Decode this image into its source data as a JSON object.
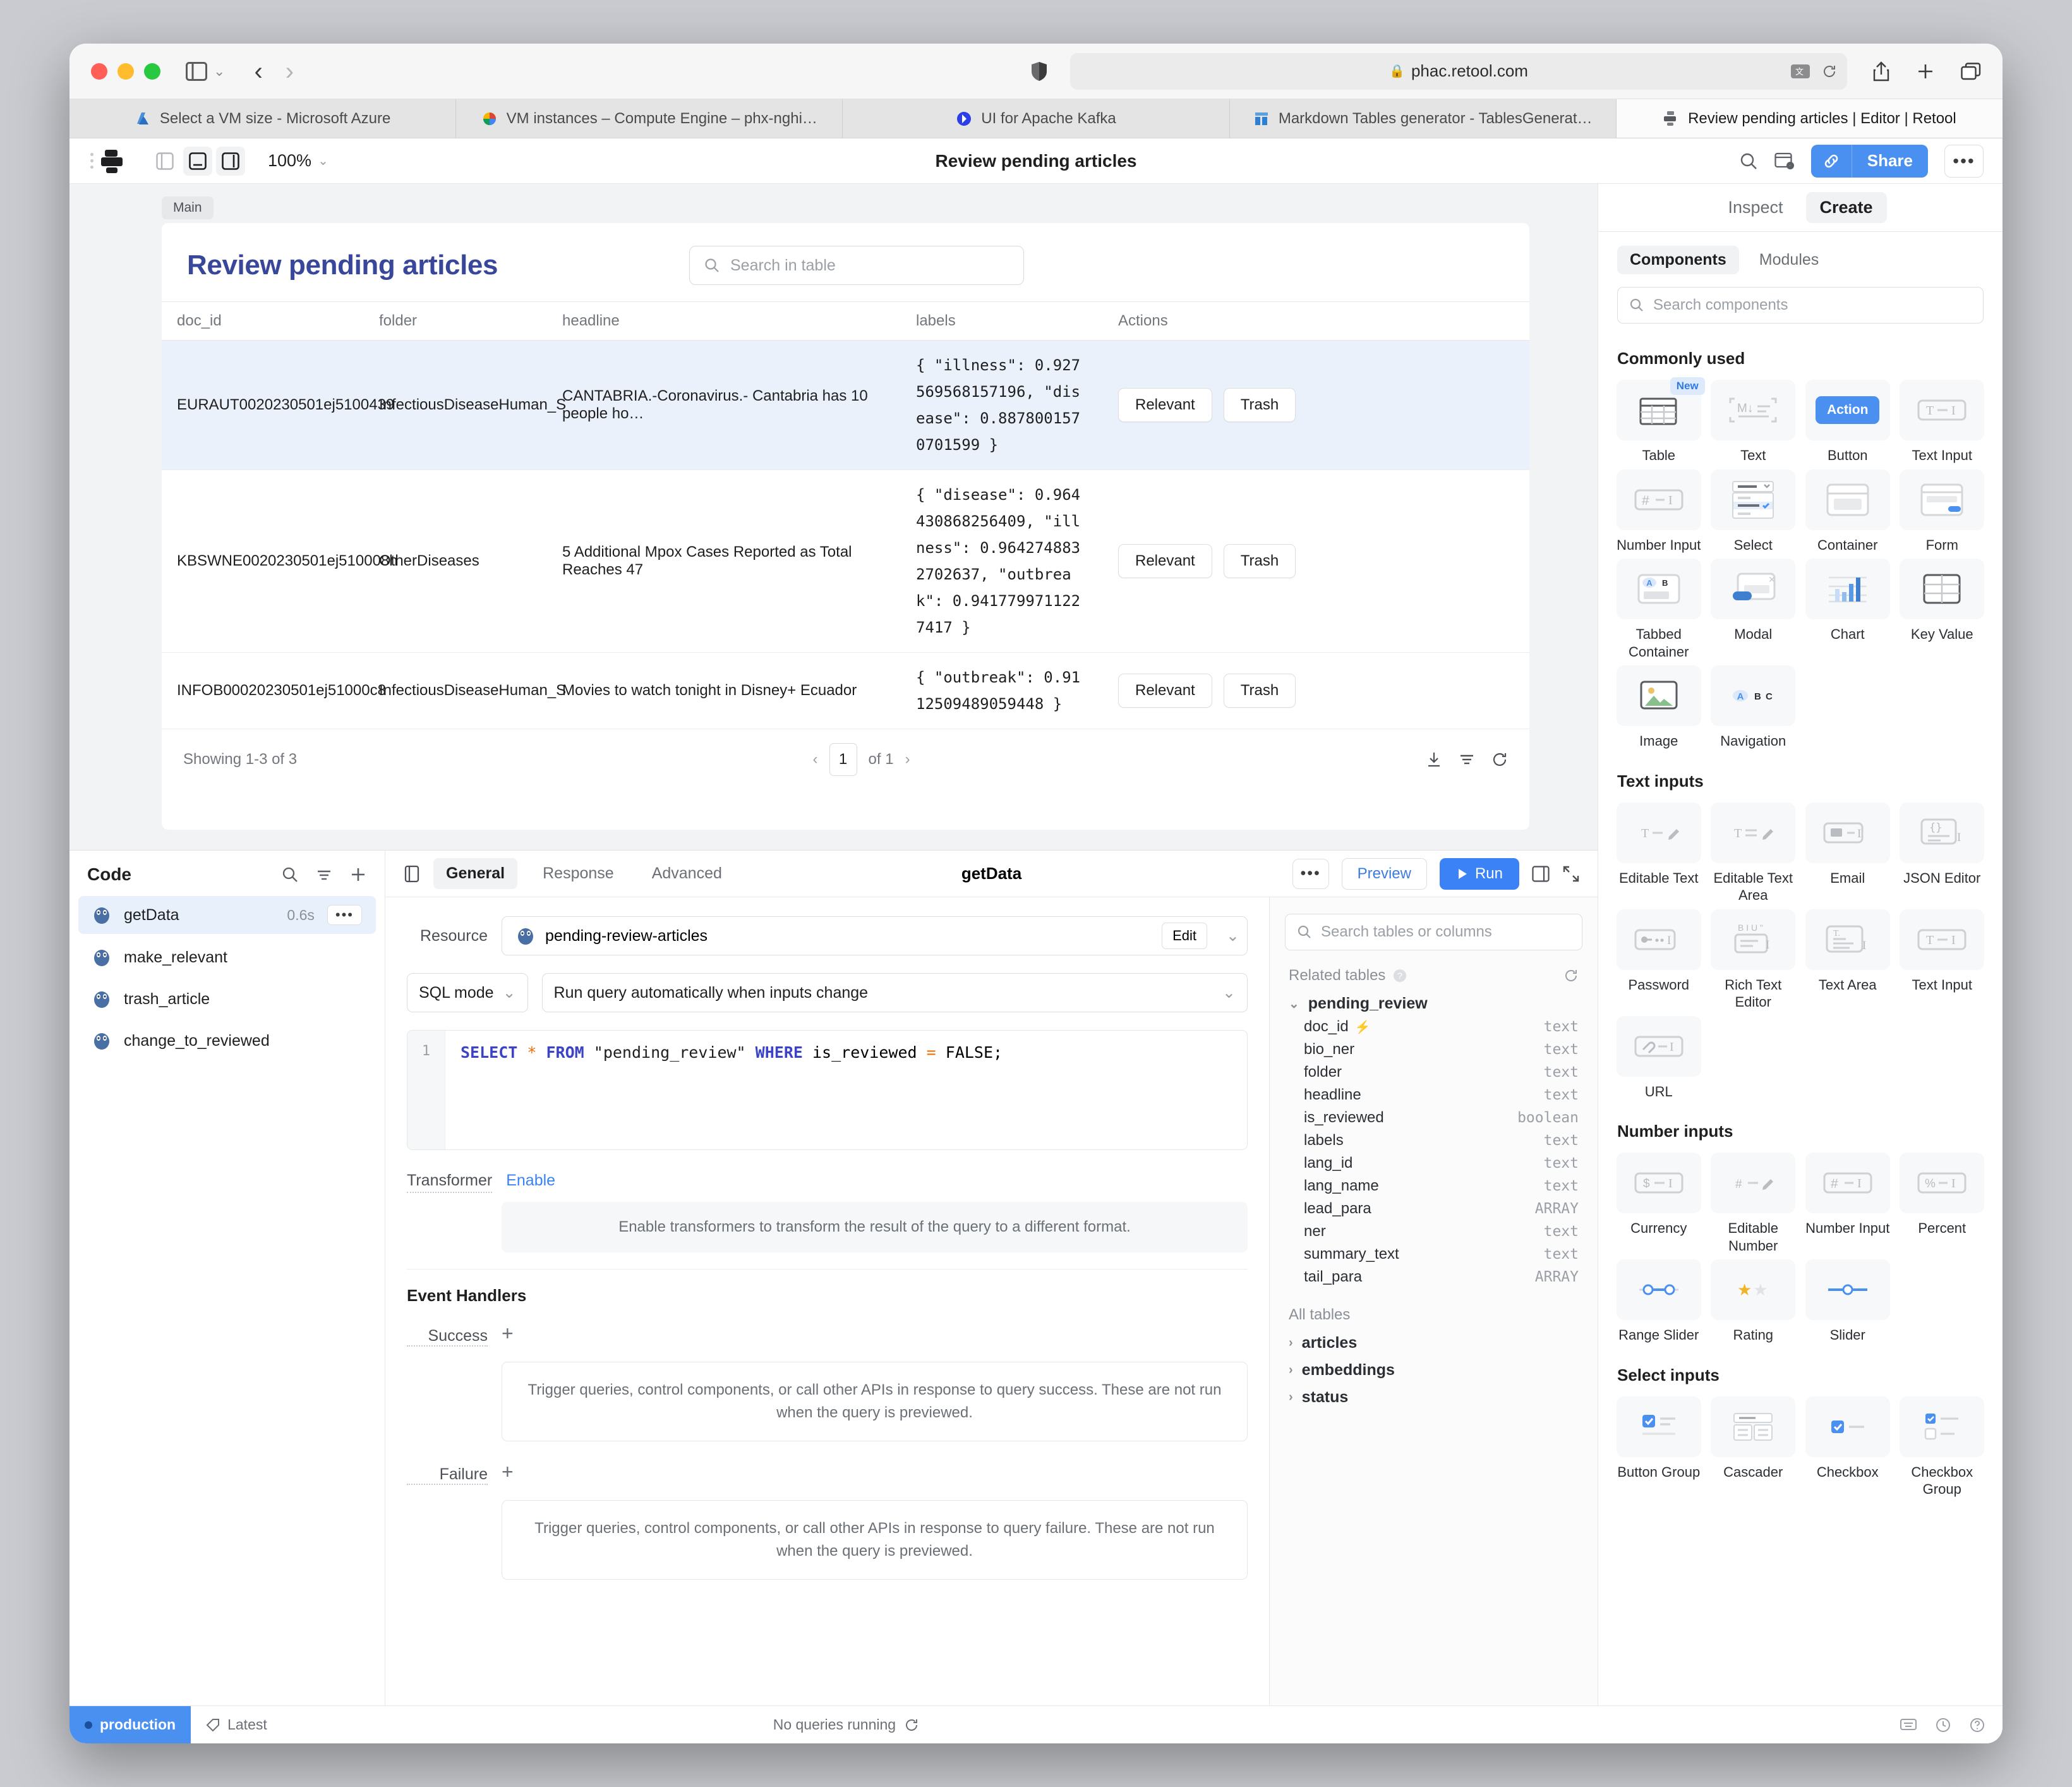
{
  "browser": {
    "url": "phac.retool.com",
    "tabs": [
      {
        "label": "Select a VM size - Microsoft Azure",
        "favicon": "azure-icon",
        "active": false
      },
      {
        "label": "VM instances – Compute Engine – phx-nghi…",
        "favicon": "google-cloud-icon",
        "active": false
      },
      {
        "label": "UI for Apache Kafka",
        "favicon": "kafka-icon",
        "active": false
      },
      {
        "label": "Markdown Tables generator - TablesGenerat…",
        "favicon": "tablesgenerator-icon",
        "active": false
      },
      {
        "label": "Review pending articles | Editor | Retool",
        "favicon": "retool-icon",
        "active": true
      }
    ]
  },
  "retool_header": {
    "zoom": "100%",
    "title": "Review pending articles",
    "share_label": "Share",
    "more_label": "•••"
  },
  "canvas": {
    "frame_chip": "Main",
    "app_title": "Review pending articles",
    "search_placeholder": "Search in table",
    "columns": [
      "doc_id",
      "folder",
      "headline",
      "labels",
      "Actions"
    ],
    "rows": [
      {
        "doc_id": "EURAUT0020230501ej5100439",
        "folder": "InfectiousDiseaseHuman_S",
        "headline": "CANTABRIA.-Coronavirus.- Cantabria has 10 people ho…",
        "labels": "{ \"illness\": 0.927569568157196, \"disease\": 0.8878001570701599 }",
        "selected": true,
        "actions": [
          "Relevant",
          "Trash"
        ]
      },
      {
        "doc_id": "KBSWNE0020230501ej510008h",
        "folder": "OtherDiseases",
        "headline": "5 Additional Mpox Cases Reported as Total Reaches 47",
        "labels": "{ \"disease\": 0.964430868256409, \"illness\": 0.9642748832702637, \"outbreak\": 0.9417799711227417 }",
        "selected": false,
        "actions": [
          "Relevant",
          "Trash"
        ]
      },
      {
        "doc_id": "INFOB00020230501ej51000c8",
        "folder": "InfectiousDiseaseHuman_S",
        "headline": "Movies to watch tonight in Disney+ Ecuador",
        "labels": "{ \"outbreak\": 0.9112509489059448 }",
        "selected": false,
        "actions": [
          "Relevant",
          "Trash"
        ]
      }
    ],
    "footer": {
      "showing": "Showing 1-3 of 3",
      "page": "1",
      "of": "of 1"
    }
  },
  "code_panel": {
    "title": "Code",
    "queries": [
      {
        "name": "getData",
        "duration": "0.6s",
        "selected": true
      },
      {
        "name": "make_relevant",
        "duration": "",
        "selected": false
      },
      {
        "name": "trash_article",
        "duration": "",
        "selected": false
      },
      {
        "name": "change_to_reviewed",
        "duration": "",
        "selected": false
      }
    ]
  },
  "editor": {
    "tabs": [
      "General",
      "Response",
      "Advanced"
    ],
    "active_tab": "General",
    "query_name": "getData",
    "preview_label": "Preview",
    "run_label": "Run",
    "resource_label": "Resource",
    "resource_value": "pending-review-articles",
    "resource_edit_label": "Edit",
    "sql_mode_label": "SQL mode",
    "run_behaviour": "Run query automatically when inputs change",
    "sql_line_number": "1",
    "sql": {
      "kw1": "SELECT",
      "star": "*",
      "kw2": "FROM",
      "table": "\"pending_review\"",
      "kw3": "WHERE",
      "col": "is_reviewed",
      "eq": "=",
      "val": "FALSE;"
    },
    "transformer_label": "Transformer",
    "transformer_enable": "Enable",
    "transformer_hint": "Enable transformers to transform the result of the query to a different format.",
    "event_handlers_title": "Event Handlers",
    "success_label": "Success",
    "success_hint": "Trigger queries, control components, or call other APIs in response to query success. These are not run when the query is previewed.",
    "failure_label": "Failure",
    "failure_hint": "Trigger queries, control components, or call other APIs in response to query failure. These are not run when the query is previewed."
  },
  "schema": {
    "search_placeholder": "Search tables or columns",
    "related_tables_label": "Related tables",
    "table_name": "pending_review",
    "columns": [
      {
        "name": "doc_id",
        "type": "text",
        "key": true
      },
      {
        "name": "bio_ner",
        "type": "text",
        "key": false
      },
      {
        "name": "folder",
        "type": "text",
        "key": false
      },
      {
        "name": "headline",
        "type": "text",
        "key": false
      },
      {
        "name": "is_reviewed",
        "type": "boolean",
        "key": false
      },
      {
        "name": "labels",
        "type": "text",
        "key": false
      },
      {
        "name": "lang_id",
        "type": "text",
        "key": false
      },
      {
        "name": "lang_name",
        "type": "text",
        "key": false
      },
      {
        "name": "lead_para",
        "type": "ARRAY",
        "key": false
      },
      {
        "name": "ner",
        "type": "text",
        "key": false
      },
      {
        "name": "summary_text",
        "type": "text",
        "key": false
      },
      {
        "name": "tail_para",
        "type": "ARRAY",
        "key": false
      }
    ],
    "all_tables_label": "All tables",
    "all_tables": [
      "articles",
      "embeddings",
      "status"
    ]
  },
  "right_panel": {
    "tabs": [
      "Inspect",
      "Create"
    ],
    "active_tab": "Create",
    "subtabs": [
      "Components",
      "Modules"
    ],
    "active_subtab": "Components",
    "search_placeholder": "Search components",
    "sections": [
      {
        "title": "Commonly used",
        "items": [
          {
            "label": "Table",
            "icon": "table-icon",
            "badge": "New"
          },
          {
            "label": "Text",
            "icon": "markdown-text-icon",
            "badge": ""
          },
          {
            "label": "Button",
            "icon": "button-action-icon",
            "badge": "",
            "inner": "Action"
          },
          {
            "label": "Text Input",
            "icon": "text-input-icon",
            "badge": ""
          },
          {
            "label": "Number Input",
            "icon": "number-input-icon",
            "badge": ""
          },
          {
            "label": "Select",
            "icon": "select-icon",
            "badge": ""
          },
          {
            "label": "Container",
            "icon": "container-icon",
            "badge": ""
          },
          {
            "label": "Form",
            "icon": "form-icon",
            "badge": ""
          },
          {
            "label": "Tabbed Container",
            "icon": "tabbed-container-icon",
            "badge": ""
          },
          {
            "label": "Modal",
            "icon": "modal-icon",
            "badge": ""
          },
          {
            "label": "Chart",
            "icon": "chart-icon",
            "badge": ""
          },
          {
            "label": "Key Value",
            "icon": "key-value-icon",
            "badge": ""
          },
          {
            "label": "Image",
            "icon": "image-icon",
            "badge": ""
          },
          {
            "label": "Navigation",
            "icon": "navigation-icon",
            "badge": ""
          }
        ]
      },
      {
        "title": "Text inputs",
        "items": [
          {
            "label": "Editable Text",
            "icon": "editable-text-icon",
            "badge": ""
          },
          {
            "label": "Editable Text Area",
            "icon": "editable-text-area-icon",
            "badge": ""
          },
          {
            "label": "Email",
            "icon": "email-icon",
            "badge": ""
          },
          {
            "label": "JSON Editor",
            "icon": "json-editor-icon",
            "badge": ""
          },
          {
            "label": "Password",
            "icon": "password-icon",
            "badge": ""
          },
          {
            "label": "Rich Text Editor",
            "icon": "rich-text-editor-icon",
            "badge": ""
          },
          {
            "label": "Text Area",
            "icon": "text-area-icon",
            "badge": ""
          },
          {
            "label": "Text Input",
            "icon": "text-input-icon",
            "badge": ""
          },
          {
            "label": "URL",
            "icon": "url-icon",
            "badge": ""
          }
        ]
      },
      {
        "title": "Number inputs",
        "items": [
          {
            "label": "Currency",
            "icon": "currency-icon",
            "badge": ""
          },
          {
            "label": "Editable Number",
            "icon": "editable-number-icon",
            "badge": ""
          },
          {
            "label": "Number Input",
            "icon": "number-input-icon",
            "badge": ""
          },
          {
            "label": "Percent",
            "icon": "percent-icon",
            "badge": ""
          },
          {
            "label": "Range Slider",
            "icon": "range-slider-icon",
            "badge": ""
          },
          {
            "label": "Rating",
            "icon": "rating-icon",
            "badge": ""
          },
          {
            "label": "Slider",
            "icon": "slider-icon",
            "badge": ""
          }
        ]
      },
      {
        "title": "Select inputs",
        "items": [
          {
            "label": "Button Group",
            "icon": "button-group-icon",
            "badge": ""
          },
          {
            "label": "Cascader",
            "icon": "cascader-icon",
            "badge": ""
          },
          {
            "label": "Checkbox",
            "icon": "checkbox-icon",
            "badge": ""
          },
          {
            "label": "Checkbox Group",
            "icon": "checkbox-group-icon",
            "badge": ""
          }
        ]
      }
    ]
  },
  "statusbar": {
    "env": "production",
    "version": "Latest",
    "queries_status": "No queries running"
  },
  "colors": {
    "accent": "#4a90f0",
    "title": "#39479b",
    "selected_row": "#eaf1fb"
  }
}
